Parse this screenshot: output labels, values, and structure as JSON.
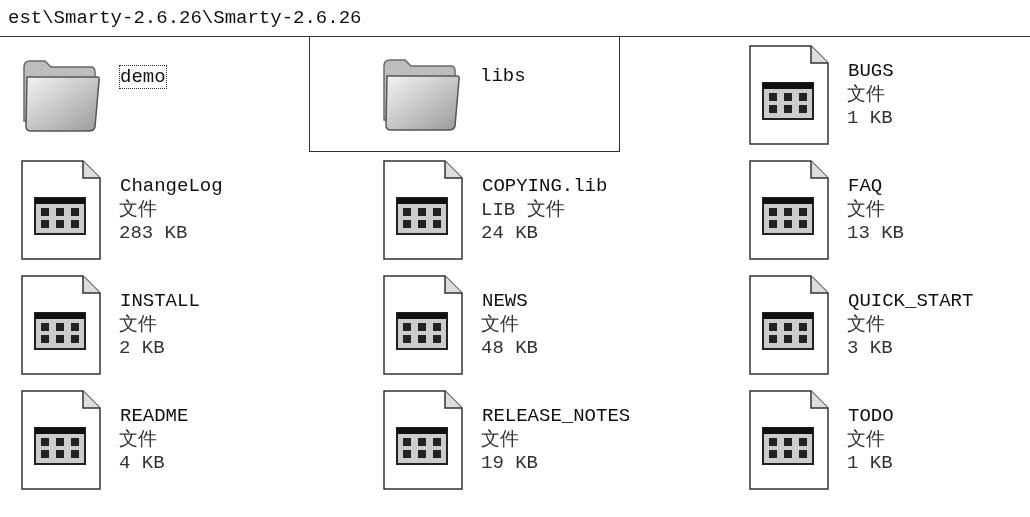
{
  "address_bar": {
    "path": "est\\Smarty-2.6.26\\Smarty-2.6.26"
  },
  "items": [
    {
      "kind": "folder",
      "name": "demo",
      "focused": true,
      "hovered": false
    },
    {
      "kind": "folder",
      "name": "libs",
      "focused": false,
      "hovered": true
    },
    {
      "kind": "file",
      "name": "BUGS",
      "type": "文件",
      "size": "1 KB",
      "focused": false,
      "hovered": false
    },
    {
      "kind": "file",
      "name": "ChangeLog",
      "type": "文件",
      "size": "283 KB",
      "focused": false,
      "hovered": false
    },
    {
      "kind": "file",
      "name": "COPYING.lib",
      "type": "LIB 文件",
      "size": "24 KB",
      "focused": false,
      "hovered": false
    },
    {
      "kind": "file",
      "name": "FAQ",
      "type": "文件",
      "size": "13 KB",
      "focused": false,
      "hovered": false
    },
    {
      "kind": "file",
      "name": "INSTALL",
      "type": "文件",
      "size": "2 KB",
      "focused": false,
      "hovered": false
    },
    {
      "kind": "file",
      "name": "NEWS",
      "type": "文件",
      "size": "48 KB",
      "focused": false,
      "hovered": false
    },
    {
      "kind": "file",
      "name": "QUICK_START",
      "type": "文件",
      "size": "3 KB",
      "focused": false,
      "hovered": false
    },
    {
      "kind": "file",
      "name": "README",
      "type": "文件",
      "size": "4 KB",
      "focused": false,
      "hovered": false
    },
    {
      "kind": "file",
      "name": "RELEASE_NOTES",
      "type": "文件",
      "size": "19 KB",
      "focused": false,
      "hovered": false
    },
    {
      "kind": "file",
      "name": "TODO",
      "type": "文件",
      "size": "1 KB",
      "focused": false,
      "hovered": false
    }
  ]
}
